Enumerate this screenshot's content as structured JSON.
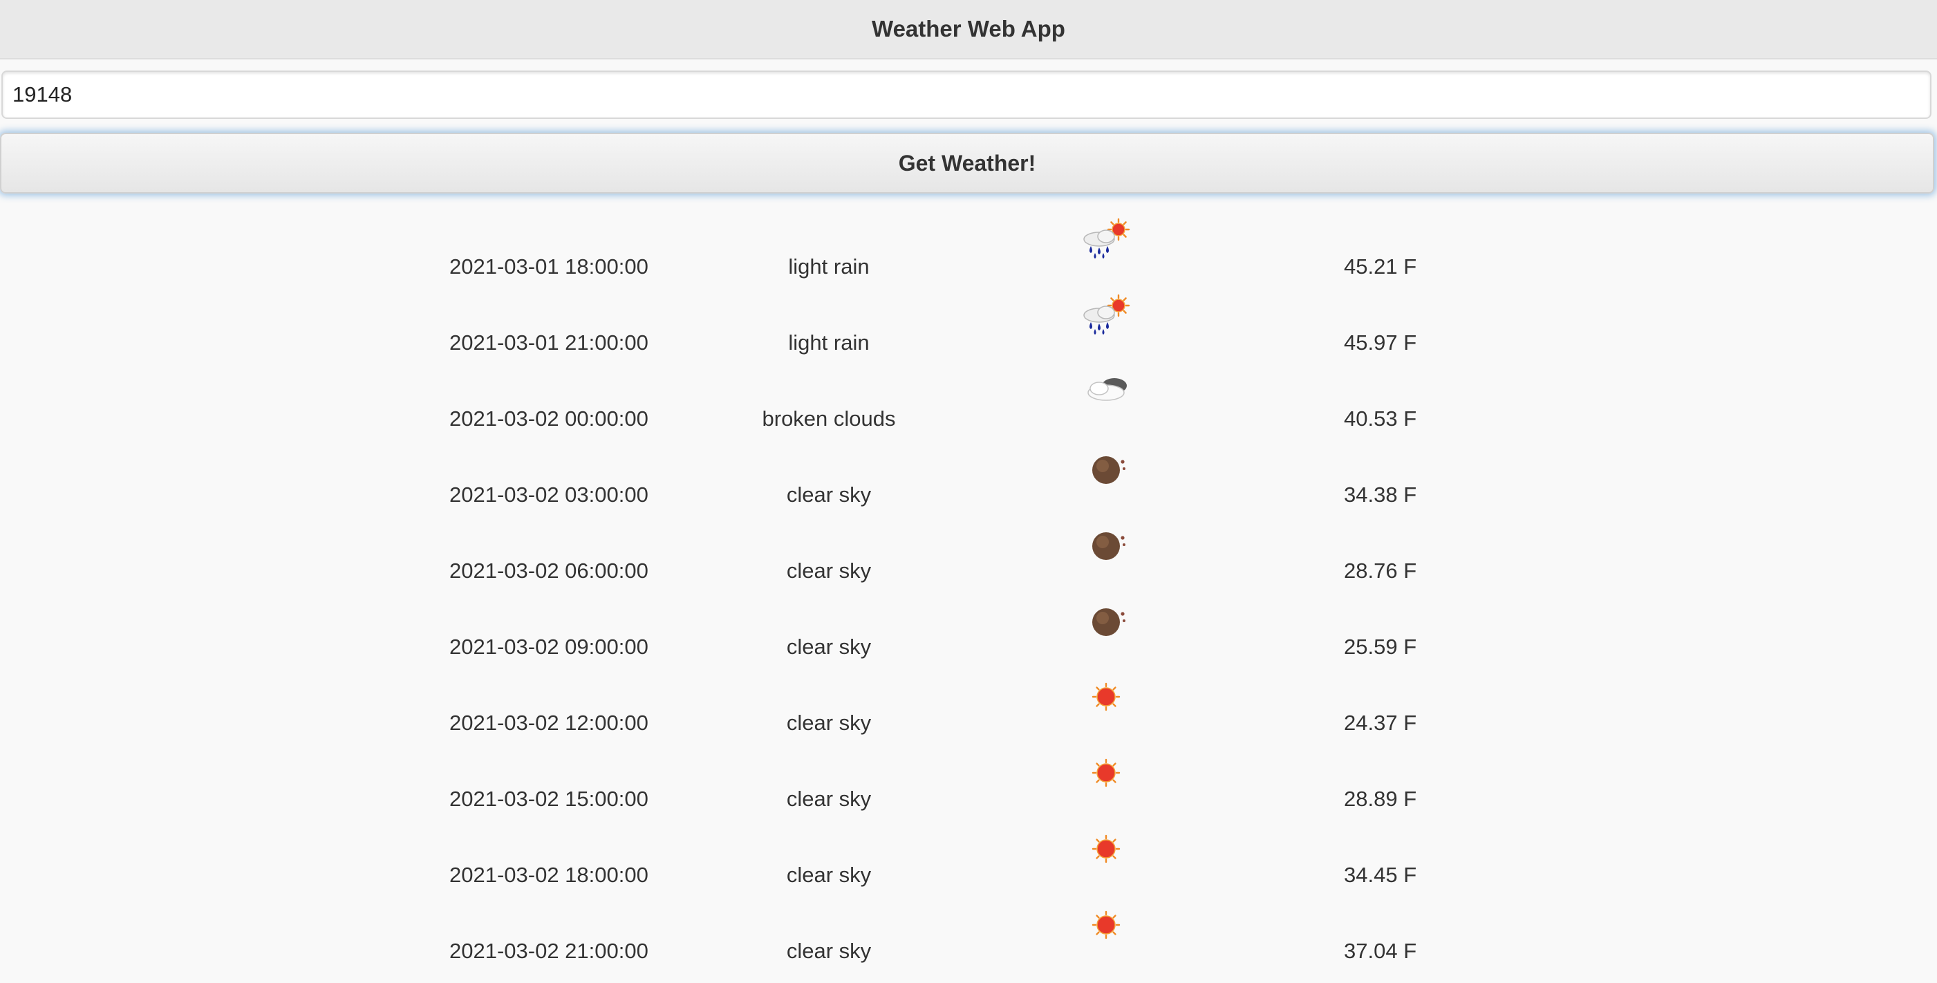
{
  "app": {
    "title": "Weather Web App"
  },
  "search": {
    "value": "19148"
  },
  "button": {
    "label": "Get Weather!"
  },
  "forecast": [
    {
      "time": "2021-03-01 18:00:00",
      "description": "light rain",
      "icon": "light-rain-icon",
      "temp": "45.21 F"
    },
    {
      "time": "2021-03-01 21:00:00",
      "description": "light rain",
      "icon": "light-rain-icon",
      "temp": "45.97 F"
    },
    {
      "time": "2021-03-02 00:00:00",
      "description": "broken clouds",
      "icon": "broken-clouds-icon",
      "temp": "40.53 F"
    },
    {
      "time": "2021-03-02 03:00:00",
      "description": "clear sky",
      "icon": "clear-night-icon",
      "temp": "34.38 F"
    },
    {
      "time": "2021-03-02 06:00:00",
      "description": "clear sky",
      "icon": "clear-night-icon",
      "temp": "28.76 F"
    },
    {
      "time": "2021-03-02 09:00:00",
      "description": "clear sky",
      "icon": "clear-night-icon",
      "temp": "25.59 F"
    },
    {
      "time": "2021-03-02 12:00:00",
      "description": "clear sky",
      "icon": "sun-icon",
      "temp": "24.37 F"
    },
    {
      "time": "2021-03-02 15:00:00",
      "description": "clear sky",
      "icon": "sun-icon",
      "temp": "28.89 F"
    },
    {
      "time": "2021-03-02 18:00:00",
      "description": "clear sky",
      "icon": "sun-icon",
      "temp": "34.45 F"
    },
    {
      "time": "2021-03-02 21:00:00",
      "description": "clear sky",
      "icon": "sun-icon",
      "temp": "37.04 F"
    }
  ],
  "colors": {
    "header_bg": "#e9e9e9",
    "page_bg": "#f9f9f9",
    "button_glow": "#3887d1",
    "text": "#333333"
  }
}
